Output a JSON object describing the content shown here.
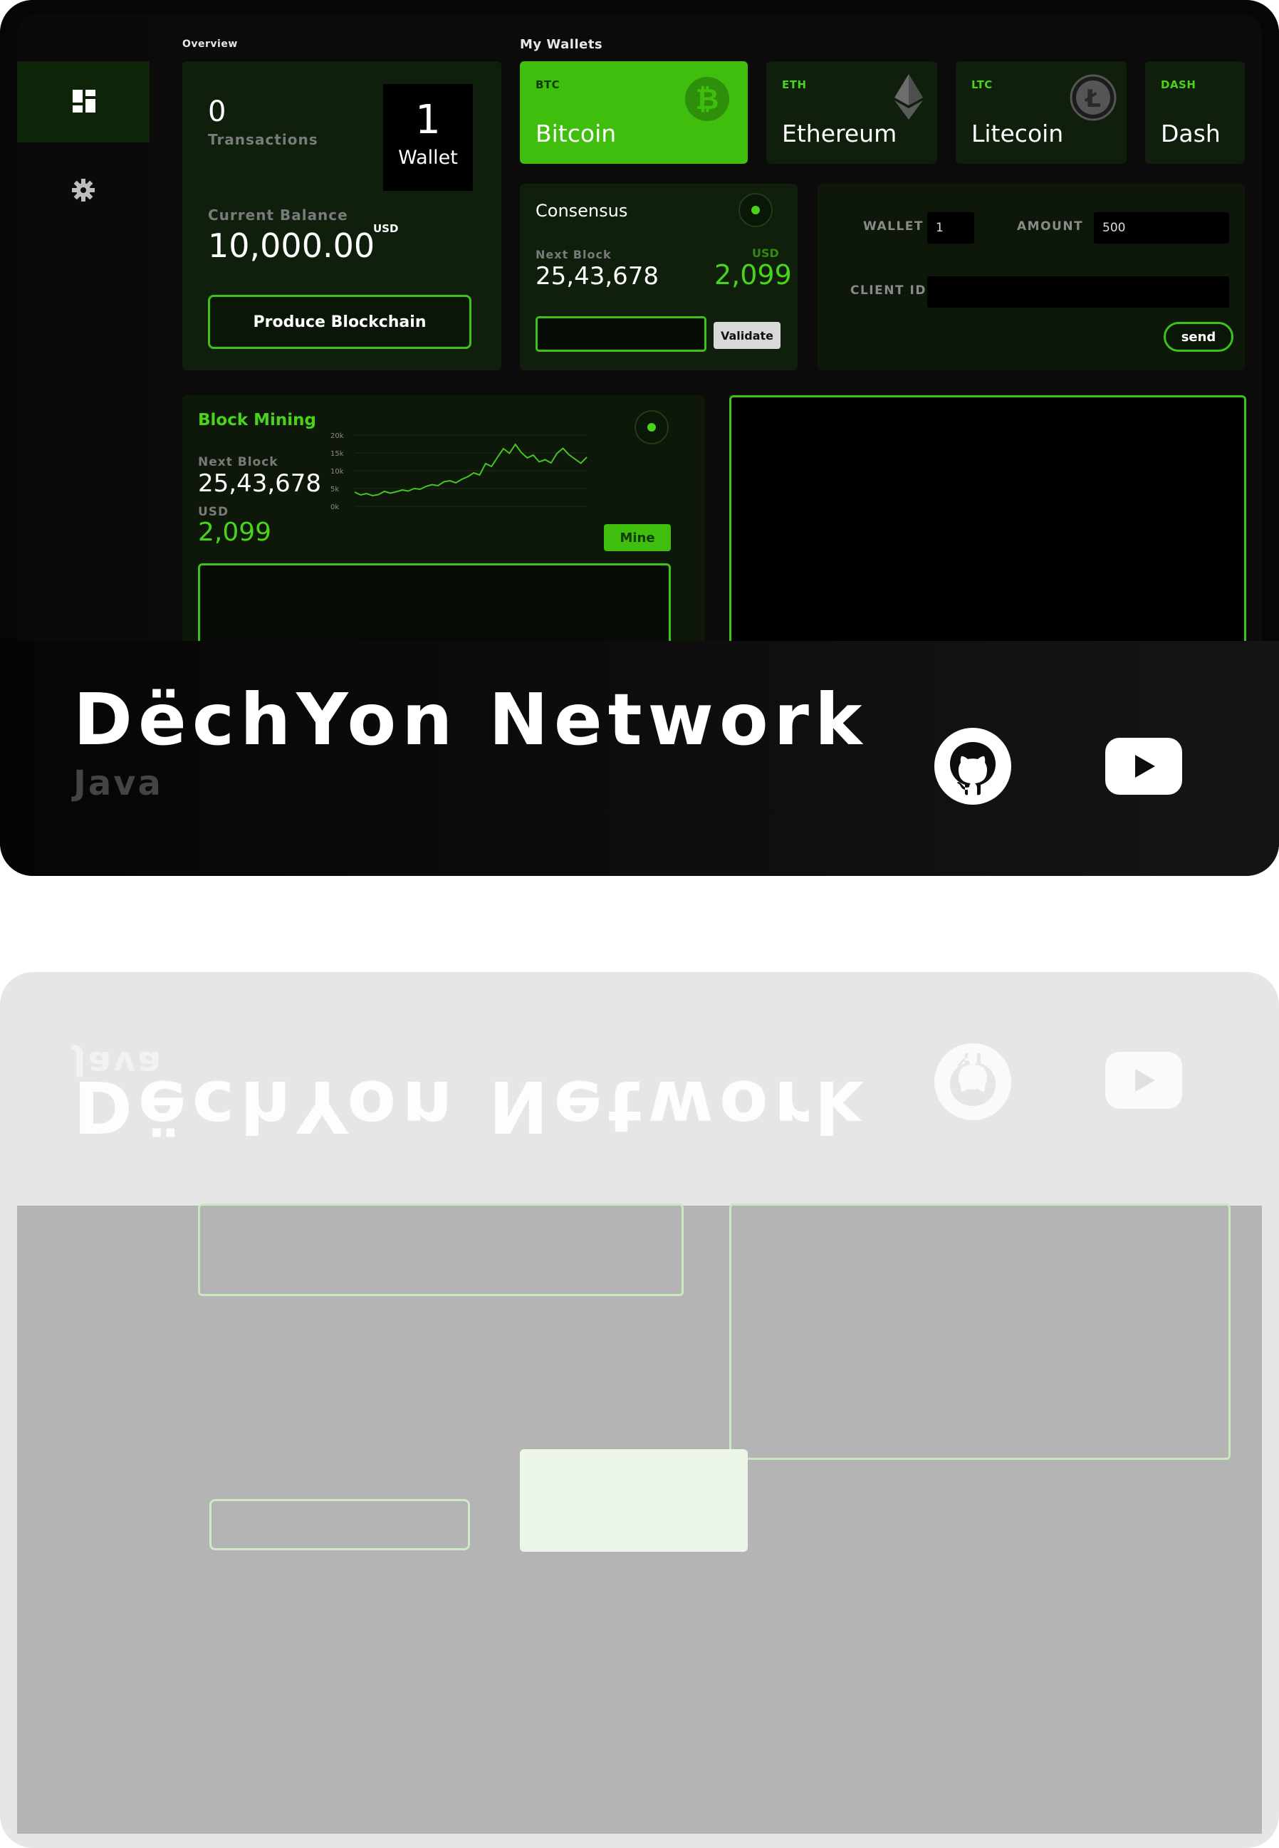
{
  "overview": {
    "section_label": "Overview",
    "transactions_count": "0",
    "transactions_label": "Transactions",
    "wallet_count": "1",
    "wallet_label": "Wallet",
    "current_balance_label": "Current Balance",
    "balance_value": "10,000.00",
    "balance_currency": "USD",
    "produce_button": "Produce Blockchain"
  },
  "wallets": {
    "section_label": "My Wallets",
    "items": [
      {
        "tag": "BTC",
        "name": "Bitcoin",
        "icon": "bitcoin-icon"
      },
      {
        "tag": "ETH",
        "name": "Ethereum",
        "icon": "ethereum-icon"
      },
      {
        "tag": "LTC",
        "name": "Litecoin",
        "icon": "litecoin-icon"
      },
      {
        "tag": "DASH",
        "name": "Dash",
        "icon": "dash-icon"
      }
    ]
  },
  "consensus": {
    "title": "Consensus",
    "next_block_label": "Next Block",
    "next_block_value": "25,43,678",
    "usd_label": "USD",
    "usd_value": "2,099",
    "validate_button": "Validate"
  },
  "transfer": {
    "wallet_label": "WALLET",
    "wallet_value": "1",
    "amount_label": "AMOUNT",
    "amount_value": "500",
    "client_id_label": "CLIENT ID",
    "client_id_value": "",
    "send_button": "send"
  },
  "mining": {
    "title": "Block Mining",
    "next_block_label": "Next Block",
    "next_block_value": "25,43,678",
    "usd_label": "USD",
    "usd_value": "2,099",
    "mine_button": "Mine"
  },
  "chart_data": {
    "type": "line",
    "ylim": [
      0,
      20000
    ],
    "yticks": [
      "20k",
      "15k",
      "10k",
      "5k",
      "0k"
    ],
    "x": [
      0,
      1,
      2,
      3,
      4,
      5,
      6,
      7,
      8,
      9,
      10,
      11,
      12,
      13,
      14,
      15,
      16,
      17,
      18,
      19,
      20,
      21,
      22,
      23,
      24,
      25,
      26,
      27,
      28,
      29,
      30,
      31,
      32,
      33,
      34,
      35,
      36,
      37,
      38,
      39
    ],
    "values": [
      4000,
      3200,
      3600,
      3000,
      3300,
      4200,
      3700,
      4100,
      4600,
      4300,
      5000,
      4800,
      5600,
      6100,
      5800,
      6900,
      7200,
      6600,
      7600,
      8300,
      9400,
      8800,
      12000,
      11200,
      13800,
      16200,
      14900,
      17400,
      15100,
      13600,
      14400,
      12500,
      13100,
      12200,
      14900,
      16300,
      14500,
      13300,
      12100,
      13800
    ],
    "color": "#46c41f"
  },
  "brand": {
    "title": "DëchYon Network",
    "subtitle": "Java",
    "github_icon": "github-icon",
    "youtube_icon": "youtube-icon"
  },
  "colors": {
    "accent": "#3fbe0e",
    "background": "#0b0b0b",
    "panel": "#0f1f0c"
  }
}
